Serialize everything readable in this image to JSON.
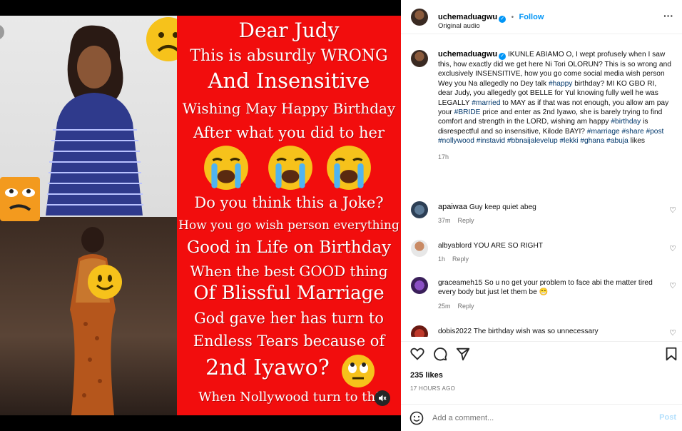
{
  "post": {
    "username": "uchemaduagwu",
    "follow_label": "Follow",
    "dot": "•",
    "audio_label": "Original audio",
    "more_label": "···"
  },
  "poster": {
    "lines": [
      "Dear Judy",
      "This is absurdly WRONG",
      "And Insensitive",
      "Wishing May Happy Birthday",
      "After what you did to her",
      "Do you think this a Joke?",
      "How you go wish person everything",
      "Good in Life on Birthday",
      "When the best GOOD thing",
      "Of Blissful Marriage",
      "God gave her has turn to",
      "Endless Tears because of",
      "2nd Iyawo?",
      "When Nollywood turn to thi"
    ]
  },
  "caption": {
    "username": "uchemaduagwu",
    "text_1": "IKUNLE ABIAMO O, I wept profusely when I saw this, how exactly did we get here Ni Tori OLORUN? This is so wrong and exclusively INSENSITIVE, how you go come social media wish person Wey you Na allegedly no Dey talk ",
    "tag_happy": "#happy",
    "text_2": " birthday? MI KO GBO RI, dear Judy, you allegedly got BELLE for Yul knowing fully well he was LEGALLY ",
    "tag_married": "#married",
    "text_3": " to MAY as if that was not enough, you allow am pay your ",
    "tag_bride": "#BRIDE",
    "text_4": " price and enter as 2nd Iyawo, she is barely trying to find comfort and strength in the LORD, wishing am happy ",
    "tag_birthday": "#birthday",
    "text_5": " is disrespectful and so insensitive, Kilode BAYI? ",
    "tags_tail": "#marriage #share #post #nollywood #instavid #bbnaijalevelup #lekki #ghana #abuja",
    "text_6": " likes",
    "time": "17h"
  },
  "comments": [
    {
      "user": "apaiwaa",
      "text": "Guy keep quiet abeg",
      "time": "37m",
      "reply": "Reply"
    },
    {
      "user": "albyablord",
      "text": "YOU ARE SO RIGHT",
      "time": "1h",
      "reply": "Reply"
    },
    {
      "user": "graceameh15",
      "text": "So u no get your problem to face abi the matter tired every body but just let them be 😁",
      "time": "25m",
      "reply": "Reply"
    },
    {
      "user": "dobis2022",
      "text": "The birthday wish was so unnecessary",
      "time": "",
      "reply": ""
    }
  ],
  "stats": {
    "likes": "235 likes",
    "date": "17 HOURS AGO"
  },
  "composer": {
    "placeholder": "Add a comment...",
    "post_label": "Post"
  },
  "icons": {
    "heart": "heart-icon",
    "comment": "comment-icon",
    "share": "share-icon",
    "save": "bookmark-icon",
    "emoji": "emoji-icon",
    "mute": "mute-icon"
  },
  "colors": {
    "poster_red": "#f20d0d",
    "link_blue": "#0095f6",
    "hashtag": "#00376b"
  }
}
